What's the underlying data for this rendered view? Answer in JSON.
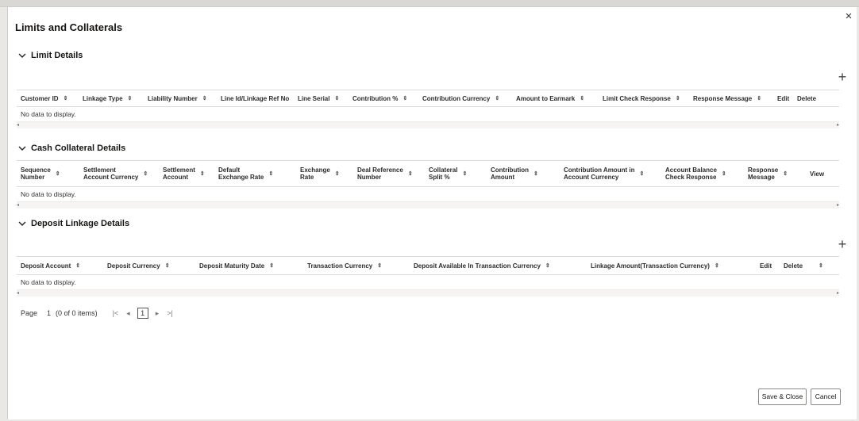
{
  "dialog": {
    "title": "Limits and Collaterals",
    "close_glyph": "×",
    "close_icon": "close-icon"
  },
  "limit_details": {
    "title": "Limit Details",
    "add_glyph": "+",
    "columns": [
      "Customer ID",
      "Linkage Type",
      "Liability Number",
      "Line Id/Linkage Ref No",
      "Line Serial",
      "Contribution %",
      "Contribution Currency",
      "Amount to Earmark",
      "Limit Check Response",
      "Response Message",
      "Edit",
      "Delete"
    ],
    "empty_text": "No data to display."
  },
  "cash_collateral": {
    "title": "Cash Collateral Details",
    "columns": [
      "Sequence\nNumber",
      "Settlement\nAccount Currency",
      "Settlement\nAccount",
      "Default\nExchange Rate",
      "Exchange\nRate",
      "Deal Reference\nNumber",
      "Collateral\nSplit %",
      "Contribution\nAmount",
      "Contribution Amount in\nAccount Currency",
      "Account Balance\nCheck Response",
      "Response\nMessage",
      "View"
    ],
    "empty_text": "No data to display."
  },
  "deposit_linkage": {
    "title": "Deposit Linkage Details",
    "add_glyph": "+",
    "columns": [
      "Deposit Account",
      "Deposit Currency",
      "Deposit Maturity Date",
      "Transaction Currency",
      "Deposit Available In Transaction Currency",
      "Linkage Amount(Transaction Currency)",
      "Edit",
      "Delete",
      ""
    ],
    "empty_text": "No data to display."
  },
  "pager": {
    "page_label": "Page",
    "page_number": "1",
    "items_text": "(0 of 0 items)",
    "first_glyph": "|<",
    "prev_glyph": "◂",
    "current": "1",
    "next_glyph": "▸",
    "last_glyph": ">|"
  },
  "footer": {
    "save_close_label": "Save & Close",
    "cancel_label": "Cancel"
  },
  "icons": {
    "sort": "sort-icon",
    "chevron": "chevron-down-icon",
    "add": "add-icon"
  },
  "glyphs": {
    "sort": "⇕",
    "scroll_left": "◂",
    "scroll_right": "▸"
  }
}
